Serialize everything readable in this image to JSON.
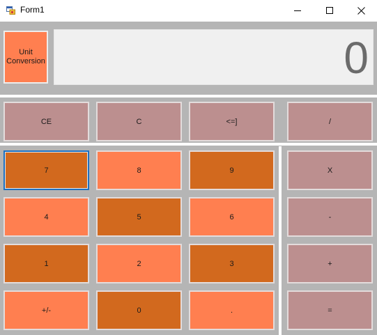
{
  "window": {
    "title": "Form1"
  },
  "display": {
    "value": "0"
  },
  "unit_button": {
    "label_line1": "Unit",
    "label_line2": "Conversion"
  },
  "colors": {
    "rose": "#bc8f8f",
    "orange": "#d2691e",
    "coral": "#ff7f50",
    "display_bg": "#f0f0f0",
    "panel_bg": "#b5b5b5"
  },
  "keys": {
    "ce": "CE",
    "c": "C",
    "backspace": "<=]",
    "divide": "/",
    "seven": "7",
    "eight": "8",
    "nine": "9",
    "multiply": "X",
    "four": "4",
    "five": "5",
    "six": "6",
    "minus": "-",
    "one": "1",
    "two": "2",
    "three": "3",
    "plus": "+",
    "negate": "+/-",
    "zero": "0",
    "decimal": ".",
    "equals": "="
  }
}
